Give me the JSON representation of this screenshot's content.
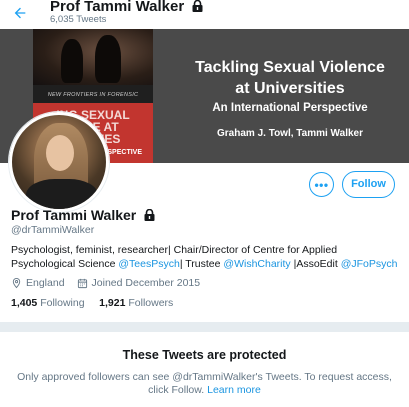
{
  "header": {
    "back_icon": "arrow-left-icon",
    "name": "Prof Tammi Walker",
    "tweet_count": "6,035 Tweets"
  },
  "banner": {
    "book_series": "NEW FRONTIERS IN FORENSIC PSYCHOLOGY",
    "book_cover_title": "ING SEXUAL\nENCE AT\nERSITIES",
    "book_cover_sub": "PERSPECTIVE",
    "title": "Tackling Sexual Violence\nat Universities",
    "subtitle": "An International Perspective",
    "authors": "Graham J. Towl, Tammi Walker"
  },
  "actions": {
    "more_label": "•••",
    "follow_label": "Follow"
  },
  "profile": {
    "name": "Prof Tammi Walker",
    "handle": "@drTammiWalker",
    "bio": {
      "part1": "Psychologist, feminist, researcher| Chair/Director of Centre for Applied Psychological Science ",
      "link1": "@TeesPsych",
      "part2": "| Trustee ",
      "link2": "@WishCharity",
      "part3": " |AssoEdit ",
      "link3": "@JFoPsych"
    },
    "location": "England",
    "joined": "Joined December 2015",
    "following_count": "1,405",
    "following_label": "Following",
    "followers_count": "1,921",
    "followers_label": "Followers"
  },
  "protected": {
    "title": "These Tweets are protected",
    "text": "Only approved followers can see @drTammiWalker's Tweets. To request access, click Follow. ",
    "learn_more": "Learn more"
  },
  "colors": {
    "accent": "#1da1f2",
    "muted": "#657786",
    "book_red": "#c2352f"
  }
}
